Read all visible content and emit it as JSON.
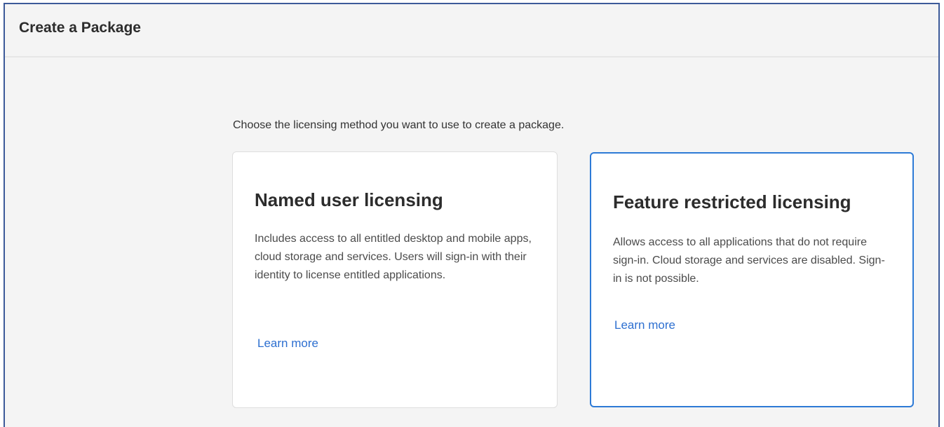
{
  "header": {
    "title": "Create a Package"
  },
  "main": {
    "instructions": "Choose the licensing method you want to use to create a package.",
    "cards": [
      {
        "title": "Named user licensing",
        "description": "Includes access to all entitled desktop and mobile apps, cloud storage and services. Users will sign-in with their identity to license entitled applications.",
        "link_label": "Learn more"
      },
      {
        "title": "Feature restricted licensing",
        "description": "Allows access to all applications that do not require sign-in. Cloud storage and services are disabled. Sign-in is not possible.",
        "link_label": "Learn more",
        "selected": true
      }
    ]
  },
  "colors": {
    "frame_border": "#3c5a99",
    "background": "#f4f4f4",
    "card_background": "#ffffff",
    "selected_border": "#2d7ad6",
    "link": "#2d6fd0"
  }
}
